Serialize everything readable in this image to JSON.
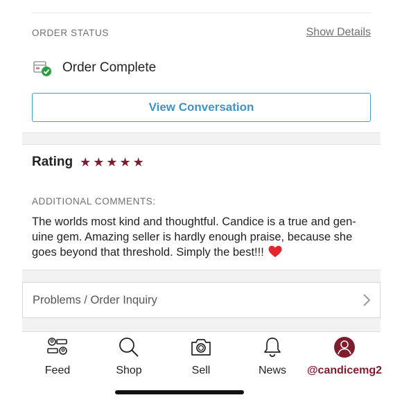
{
  "order_status": {
    "label": "ORDER STATUS",
    "show_details": "Show Details",
    "status": "Order Complete",
    "view_conversation": "View Conversation"
  },
  "rating": {
    "label": "Rating",
    "stars": 5,
    "star_color": "#7f1d2e",
    "comments_label": "ADDITIONAL COMMENTS:",
    "comments_text": "The worlds most kind and thoughtful. Candice is a true and gen-uine gem. Amazing seller is hardly enough praise, because she goes beyond that threshold. Simply the best!!!"
  },
  "inquiry": {
    "label": "Problems / Order Inquiry"
  },
  "tabbar": {
    "tabs": [
      {
        "label": "Feed",
        "icon": "feed-icon"
      },
      {
        "label": "Shop",
        "icon": "search-icon"
      },
      {
        "label": "Sell",
        "icon": "camera-icon"
      },
      {
        "label": "News",
        "icon": "bell-icon"
      },
      {
        "label": "@candicemg2",
        "icon": "avatar-icon"
      }
    ]
  },
  "colors": {
    "accent_blue": "#3f93c4",
    "brand_maroon": "#7f1d2e",
    "success_green": "#2e9e44"
  }
}
